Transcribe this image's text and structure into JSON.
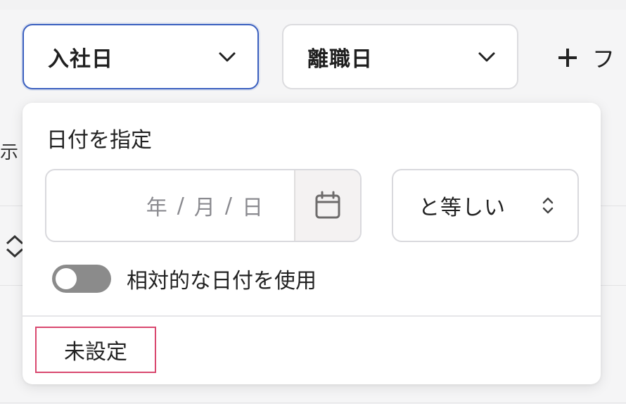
{
  "filters": [
    {
      "label": "入社日",
      "icon": "chevron-down-icon",
      "active": true
    },
    {
      "label": "離職日",
      "icon": "chevron-down-icon",
      "active": false
    }
  ],
  "add_filter": {
    "label": "フ",
    "icon": "plus-icon"
  },
  "background": {
    "cut_label": "示"
  },
  "popover": {
    "title": "日付を指定",
    "date_input": {
      "year": "年",
      "month": "月",
      "day": "日",
      "separator": "/",
      "icon": "calendar-icon"
    },
    "operator": {
      "value": "と等しい",
      "icon": "up-down-chevron-icon"
    },
    "relative": {
      "label": "相対的な日付を使用",
      "enabled": false
    },
    "unset_label": "未設定"
  },
  "colors": {
    "accent_border": "#3a5fbf",
    "focus_outline": "#d9486f",
    "toggle_off": "#8b8b8b"
  }
}
